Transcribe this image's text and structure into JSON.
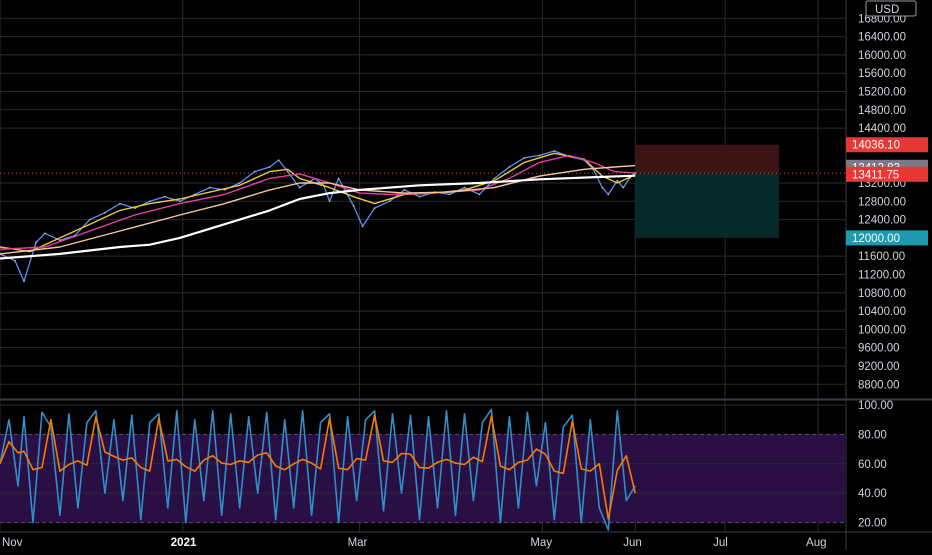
{
  "chart_data": [
    {
      "type": "line",
      "panel": "price",
      "currency_label": "USD",
      "y_ticks": [
        "16800.00",
        "16400.00",
        "16000.00",
        "15600.00",
        "15200.00",
        "14800.00",
        "14400.00",
        "13200.00",
        "12800.00",
        "12400.00",
        "11600.00",
        "11200.00",
        "10800.00",
        "10400.00",
        "10000.00",
        "9600.00",
        "9200.00",
        "8800.00"
      ],
      "y_tick_values": [
        16800,
        16400,
        16000,
        15600,
        15200,
        14800,
        14400,
        13200,
        12800,
        12400,
        11600,
        11200,
        10800,
        10400,
        10000,
        9600,
        9200,
        8800
      ],
      "ylim": [
        8500,
        17200
      ],
      "x_labels": [
        "Nov",
        "2021",
        "Mar",
        "May",
        "Jun",
        "Jul",
        "Aug"
      ],
      "x_label_days": [
        0,
        61,
        120,
        181,
        212,
        242,
        273
      ],
      "xlim_days": [
        0,
        282
      ],
      "series": [
        {
          "key": "price",
          "color": "#5b8ff9",
          "points": [
            [
              0,
              11650
            ],
            [
              5,
              11500
            ],
            [
              8,
              11050
            ],
            [
              12,
              11900
            ],
            [
              15,
              12100
            ],
            [
              20,
              11950
            ],
            [
              25,
              12050
            ],
            [
              30,
              12400
            ],
            [
              35,
              12550
            ],
            [
              40,
              12750
            ],
            [
              45,
              12650
            ],
            [
              50,
              12800
            ],
            [
              55,
              12900
            ],
            [
              60,
              12800
            ],
            [
              65,
              12950
            ],
            [
              70,
              13100
            ],
            [
              75,
              13050
            ],
            [
              80,
              13200
            ],
            [
              85,
              13450
            ],
            [
              90,
              13550
            ],
            [
              93,
              13700
            ],
            [
              96,
              13450
            ],
            [
              100,
              13100
            ],
            [
              105,
              13300
            ],
            [
              108,
              13150
            ],
            [
              110,
              12800
            ],
            [
              113,
              13300
            ],
            [
              118,
              12700
            ],
            [
              121,
              12250
            ],
            [
              125,
              12650
            ],
            [
              130,
              12800
            ],
            [
              135,
              13050
            ],
            [
              140,
              12900
            ],
            [
              145,
              13000
            ],
            [
              150,
              12950
            ],
            [
              155,
              13100
            ],
            [
              160,
              12950
            ],
            [
              165,
              13300
            ],
            [
              170,
              13550
            ],
            [
              175,
              13750
            ],
            [
              180,
              13800
            ],
            [
              185,
              13900
            ],
            [
              190,
              13780
            ],
            [
              195,
              13700
            ],
            [
              198,
              13500
            ],
            [
              201,
              13100
            ],
            [
              203,
              12950
            ],
            [
              206,
              13250
            ],
            [
              208,
              13100
            ],
            [
              210,
              13300
            ],
            [
              212,
              13420
            ]
          ]
        },
        {
          "key": "ema-fast",
          "color": "#e8c840",
          "points": [
            [
              0,
              11800
            ],
            [
              10,
              11700
            ],
            [
              20,
              12000
            ],
            [
              30,
              12300
            ],
            [
              40,
              12600
            ],
            [
              50,
              12750
            ],
            [
              60,
              12850
            ],
            [
              70,
              13000
            ],
            [
              80,
              13150
            ],
            [
              90,
              13450
            ],
            [
              96,
              13500
            ],
            [
              100,
              13300
            ],
            [
              110,
              13100
            ],
            [
              118,
              12900
            ],
            [
              125,
              12750
            ],
            [
              135,
              12950
            ],
            [
              145,
              12980
            ],
            [
              155,
              13050
            ],
            [
              165,
              13250
            ],
            [
              175,
              13650
            ],
            [
              185,
              13850
            ],
            [
              195,
              13720
            ],
            [
              201,
              13350
            ],
            [
              206,
              13200
            ],
            [
              212,
              13380
            ]
          ]
        },
        {
          "key": "ema-mid",
          "color": "#e53fa0",
          "points": [
            [
              0,
              11750
            ],
            [
              15,
              11800
            ],
            [
              30,
              12150
            ],
            [
              45,
              12500
            ],
            [
              60,
              12750
            ],
            [
              75,
              12950
            ],
            [
              90,
              13300
            ],
            [
              100,
              13400
            ],
            [
              110,
              13200
            ],
            [
              120,
              12980
            ],
            [
              130,
              12950
            ],
            [
              145,
              12980
            ],
            [
              160,
              13050
            ],
            [
              170,
              13300
            ],
            [
              180,
              13650
            ],
            [
              190,
              13800
            ],
            [
              198,
              13650
            ],
            [
              205,
              13450
            ],
            [
              212,
              13420
            ]
          ]
        },
        {
          "key": "ema-slow",
          "color": "#f5c89a",
          "points": [
            [
              0,
              11650
            ],
            [
              20,
              11800
            ],
            [
              40,
              12150
            ],
            [
              60,
              12500
            ],
            [
              75,
              12750
            ],
            [
              90,
              13050
            ],
            [
              100,
              13200
            ],
            [
              110,
              13200
            ],
            [
              120,
              13050
            ],
            [
              135,
              12980
            ],
            [
              150,
              13000
            ],
            [
              165,
              13100
            ],
            [
              180,
              13350
            ],
            [
              195,
              13500
            ],
            [
              205,
              13550
            ],
            [
              212,
              13580
            ]
          ]
        },
        {
          "key": "sma-200",
          "color": "#ffffff",
          "points": [
            [
              0,
              11550
            ],
            [
              20,
              11650
            ],
            [
              40,
              11800
            ],
            [
              50,
              11850
            ],
            [
              60,
              12000
            ],
            [
              75,
              12300
            ],
            [
              90,
              12600
            ],
            [
              100,
              12850
            ],
            [
              110,
              12980
            ],
            [
              120,
              13050
            ],
            [
              140,
              13150
            ],
            [
              160,
              13200
            ],
            [
              180,
              13280
            ],
            [
              200,
              13330
            ],
            [
              212,
              13360
            ]
          ]
        }
      ],
      "position": {
        "start_day": 212,
        "end_day": 260,
        "stop_price": 14036.1,
        "entry_price": 13411.75,
        "target_price": 12000.0,
        "loss_color": "#3b1414",
        "profit_color": "#07292a"
      },
      "badges": [
        {
          "value": "14036.10",
          "color": "#e53935",
          "text_color": "#ffffff"
        },
        {
          "value": "13412.83",
          "color": "#787b86",
          "text_color": "#ffffff"
        },
        {
          "value": "13411.75",
          "color": "#e53935",
          "text_color": "#ffffff"
        },
        {
          "value": "12000.00",
          "color": "#1e9aaf",
          "text_color": "#ffffff"
        }
      ],
      "badge_prices": [
        14036.1,
        13412.83,
        13411.75,
        12000.0
      ]
    },
    {
      "type": "line",
      "panel": "stochastic",
      "y_ticks": [
        "100.00",
        "80.00",
        "60.00",
        "40.00",
        "20.00"
      ],
      "y_tick_values": [
        100,
        80,
        60,
        40,
        20
      ],
      "ylim": [
        15,
        102
      ],
      "band": [
        20,
        80
      ],
      "band_color": "#2a0f45",
      "series": [
        {
          "key": "k-line",
          "color": "#2f8fc9"
        },
        {
          "key": "d-line",
          "color": "#f57c00"
        }
      ],
      "oscillation_days": [
        0,
        3,
        6,
        8,
        11,
        14,
        17,
        20,
        23,
        26,
        29,
        32,
        35,
        38,
        41,
        44,
        47,
        50,
        53,
        56,
        59,
        62,
        65,
        68,
        71,
        74,
        77,
        80,
        83,
        86,
        89,
        92,
        95,
        98,
        101,
        104,
        107,
        110,
        113,
        116,
        119,
        122,
        125,
        128,
        131,
        134,
        137,
        140,
        143,
        146,
        149,
        152,
        155,
        158,
        161,
        164,
        167,
        170,
        173,
        176,
        179,
        182,
        185,
        188,
        191,
        194,
        197,
        200,
        203,
        206,
        209,
        212
      ],
      "oscillation_values": [
        60,
        90,
        45,
        92,
        20,
        95,
        85,
        25,
        94,
        30,
        88,
        96,
        40,
        90,
        35,
        93,
        22,
        88,
        94,
        30,
        96,
        20,
        90,
        35,
        96,
        25,
        94,
        30,
        92,
        40,
        95,
        22,
        90,
        30,
        96,
        25,
        88,
        94,
        20,
        92,
        35,
        90,
        96,
        28,
        94,
        40,
        93,
        22,
        92,
        30,
        96,
        25,
        94,
        35,
        88,
        97,
        20,
        92,
        30,
        95,
        45,
        88,
        22,
        85,
        93,
        20,
        90,
        30,
        15,
        96,
        35,
        45
      ]
    }
  ]
}
